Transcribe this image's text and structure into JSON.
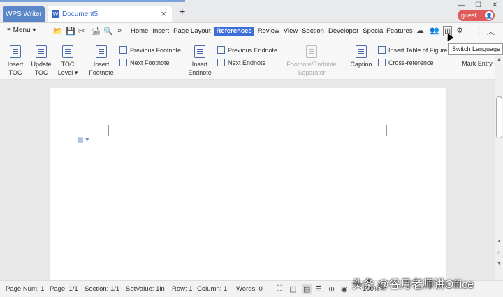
{
  "titlebar": {
    "app_tab": "WPS Writer",
    "doc_tab": "Document5",
    "doc_icon": "W",
    "close_glyph": "×",
    "new_tab_glyph": "+",
    "minimize": "—",
    "maximize": "☐",
    "close": "✕",
    "guest_label": "guest ...",
    "avatar_glyph": "👤"
  },
  "menubar": {
    "menu_label": "≡ Menu ▾",
    "quick_icons": [
      "📂",
      "💾",
      "✂",
      "🖨",
      "🔍",
      "»"
    ],
    "tabs": [
      "Home",
      "Insert",
      "Page Layout",
      "References",
      "Review",
      "View",
      "Section",
      "Developer",
      "Special Features"
    ],
    "active_tab": "References",
    "right_icons": [
      "☁",
      "👥",
      "⊞",
      "⚙",
      "⋮",
      "︿"
    ]
  },
  "ribbon": {
    "insert_toc": "Insert\nTOC",
    "update_toc": "Update\nTOC",
    "toc_level": "TOC\nLevel ▾",
    "insert_footnote": "Insert\nFootnote",
    "previous_footnote": "Previous Footnote",
    "next_footnote": "Next Footnote",
    "insert_endnote": "Insert\nEndnote",
    "previous_endnote": "Previous Endnote",
    "next_endnote": "Next Endnote",
    "separator": "Footnote/Endnote\nSeparator",
    "caption": "Caption",
    "insert_table_of_figures": "Insert Table of Figure",
    "cross_reference": "Cross-reference",
    "mark_entry": "Mark Entry"
  },
  "tooltip": "Switch Language",
  "status": {
    "page_num": "Page Num: 1",
    "page": "Page: 1/1",
    "section": "Section: 1/1",
    "setvalue": "SetValue: 1in",
    "row": "Row: 1",
    "column": "Column: 1",
    "words": "Words: 0",
    "zoom": "100%"
  },
  "watermark": "头条 @谷月老师讲Office"
}
